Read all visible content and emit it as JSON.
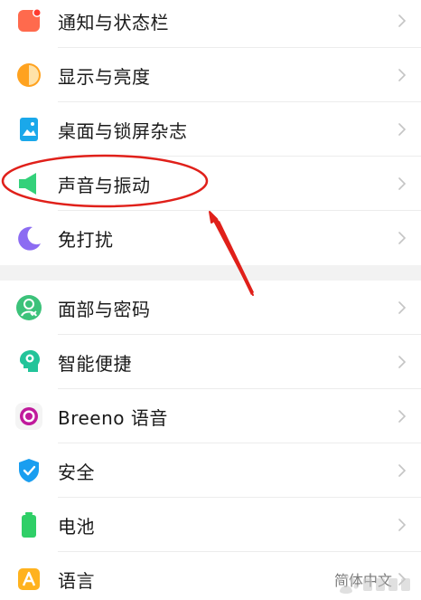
{
  "settings": {
    "group1": [
      {
        "label": "通知与状态栏",
        "icon": "notification-icon",
        "color": "#ff6a4d"
      },
      {
        "label": "显示与亮度",
        "icon": "display-brightness-icon",
        "color": "#ffa21f"
      },
      {
        "label": "桌面与锁屏杂志",
        "icon": "wallpaper-icon",
        "color": "#1aa8ea"
      },
      {
        "label": "声音与振动",
        "icon": "speaker-icon",
        "color": "#33d17a"
      },
      {
        "label": "免打扰",
        "icon": "moon-icon",
        "color": "#8c6cf2"
      }
    ],
    "group2": [
      {
        "label": "面部与密码",
        "icon": "face-password-icon",
        "color": "#3cc27a"
      },
      {
        "label": "智能便捷",
        "icon": "smart-head-icon",
        "color": "#23c49a"
      },
      {
        "label": "Breeno 语音",
        "icon": "breeno-icon",
        "color": "#c01a9c"
      },
      {
        "label": "安全",
        "icon": "shield-icon",
        "color": "#1a9ef0"
      },
      {
        "label": "电池",
        "icon": "battery-icon",
        "color": "#2fcf67"
      },
      {
        "label": "语言",
        "icon": "language-icon",
        "color": "#ffb21e",
        "value": "简体中文"
      }
    ]
  },
  "annotation": {
    "color": "#e0201a",
    "target": "声音与振动"
  }
}
